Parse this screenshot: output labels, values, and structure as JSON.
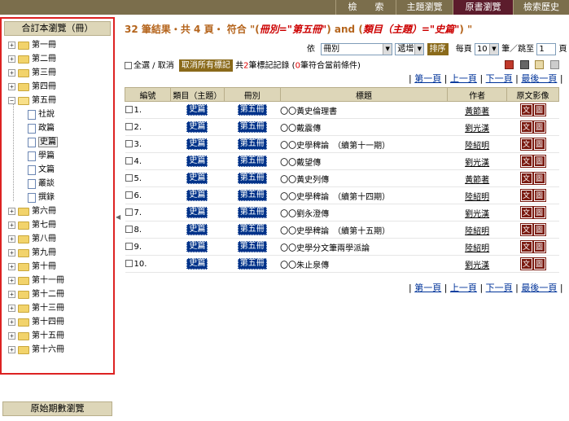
{
  "nav": {
    "tabs": [
      {
        "label": "檢　　索"
      },
      {
        "label": "主題瀏覽"
      },
      {
        "label": "原書瀏覽"
      },
      {
        "label": "檢索歷史"
      }
    ],
    "active": 2
  },
  "sidebar": {
    "header": "合訂本瀏覽（冊）",
    "volumes": [
      "第一冊",
      "第二冊",
      "第三冊",
      "第四冊",
      "第五冊"
    ],
    "open_children": [
      "社說",
      "政篇",
      "史篇",
      "學篇",
      "文篇",
      "叢談",
      "撰錄"
    ],
    "volumes_after": [
      "第六冊",
      "第七冊",
      "第八冊",
      "第九冊",
      "第十冊",
      "第十一冊",
      "第十二冊",
      "第十三冊",
      "第十四冊",
      "第十五冊",
      "第十六冊"
    ],
    "selected_child": "史篇",
    "bottom_tab": "原始期數瀏覽"
  },
  "summary": {
    "prefix": "32 筆結果・共 4 頁・ 符合 \"(",
    "q1": "冊別=\"第五冊\"",
    "mid": ") and (",
    "q2": "類目（主題）=\"史篇\"",
    "suffix": ") \""
  },
  "sortbar": {
    "label_by": "依",
    "field": "冊別",
    "order": "遞增",
    "sort_button": "排序",
    "per_page_label": "每頁",
    "per_page": "10",
    "jump_label": "筆／跳至",
    "jump_value": "1",
    "page_label": "頁",
    "go": "GO"
  },
  "selbar": {
    "select_all": "全選 / 取消",
    "clear_button": "取消所有標記",
    "pre": "共",
    "marked": "2",
    "mid": "筆標記記錄 (",
    "current": "0",
    "post": "筆符合當前條件)"
  },
  "pager": {
    "first": "第一頁",
    "prev": "上一頁",
    "next": "下一頁",
    "last": "最後一頁",
    "sep": "|"
  },
  "table": {
    "headers": [
      "編號",
      "類目（主題）",
      "冊別",
      "標題",
      "作者",
      "原文影像"
    ],
    "rows": [
      {
        "no": "1.",
        "cat": "史篇",
        "vol": "第五冊",
        "title": "〇〇黃史倫理書",
        "author": "黃節著"
      },
      {
        "no": "2.",
        "cat": "史篇",
        "vol": "第五冊",
        "title": "〇〇戴震傳",
        "author": "劉光漢"
      },
      {
        "no": "3.",
        "cat": "史篇",
        "vol": "第五冊",
        "title": "〇〇史學稗論　（續第十一期）",
        "author": "陸紹明"
      },
      {
        "no": "4.",
        "cat": "史篇",
        "vol": "第五冊",
        "title": "〇〇戴望傳",
        "author": "劉光漢"
      },
      {
        "no": "5.",
        "cat": "史篇",
        "vol": "第五冊",
        "title": "〇〇黃史列傳",
        "author": "黃節著"
      },
      {
        "no": "6.",
        "cat": "史篇",
        "vol": "第五冊",
        "title": "〇〇史學稗論　（續第十四期）",
        "author": "陸紹明"
      },
      {
        "no": "7.",
        "cat": "史篇",
        "vol": "第五冊",
        "title": "〇〇劉永澄傳",
        "author": "劉光漢"
      },
      {
        "no": "8.",
        "cat": "史篇",
        "vol": "第五冊",
        "title": "〇〇史學稗論　（續第十五期）",
        "author": "陸紹明"
      },
      {
        "no": "9.",
        "cat": "史篇",
        "vol": "第五冊",
        "title": "〇〇史學分文筆兩學派論",
        "author": "陸紹明"
      },
      {
        "no": "10.",
        "cat": "史篇",
        "vol": "第五冊",
        "title": "〇〇朱止泉傳",
        "author": "劉光漢"
      }
    ],
    "btn_text": "文",
    "btn_image": "圖"
  }
}
